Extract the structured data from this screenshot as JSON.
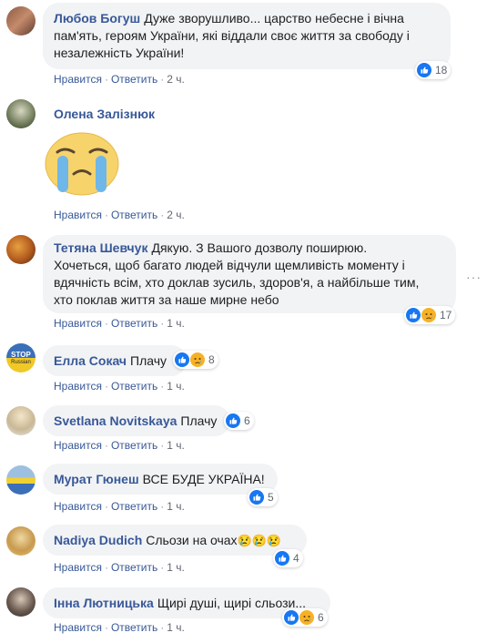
{
  "comments": [
    {
      "author": "Любов Богуш",
      "text_lines": [
        "Дуже зворушливо... царство небесне і вічна",
        "пам'ять, героям України, які віддали своє життя за свободу і",
        "незалежність України!"
      ],
      "like": "Нравится",
      "reply": "Ответить",
      "time": "2 ч.",
      "reactions": [
        "like-reaction-icon"
      ],
      "reaction_count": "18"
    },
    {
      "author": "Олена Залізнюк",
      "text": "",
      "like": "Нравится",
      "reply": "Ответить",
      "time": "2 ч.",
      "sticker": "crying-sticker"
    },
    {
      "author": "Тетяна Шевчук",
      "text_lines": [
        "Дякую. З Вашого дозволу поширюю.",
        "Хочеться, щоб багато людей відчули щемливість моменту і",
        "вдячність всім, хто доклав зусиль, здоров'я, а найбільше тим,",
        "хто поклав життя за наше мирне небо"
      ],
      "like": "Нравится",
      "reply": "Ответить",
      "time": "1 ч.",
      "reactions": [
        "like-reaction-icon",
        "sad-reaction-icon"
      ],
      "reaction_count": "17"
    },
    {
      "author": "Елла Сокач",
      "text": "Плачу",
      "like": "Нравится",
      "reply": "Ответить",
      "time": "1 ч.",
      "reactions": [
        "like-reaction-icon",
        "sad-reaction-icon"
      ],
      "reaction_count": "8",
      "avatar_text": [
        "STOP",
        "Russian"
      ]
    },
    {
      "author": "Svetlana Novitskaya",
      "text": "Плачу",
      "like": "Нравится",
      "reply": "Ответить",
      "time": "1 ч.",
      "reactions": [
        "like-reaction-icon"
      ],
      "reaction_count": "6"
    },
    {
      "author": "Мурат Гюнеш",
      "text": "ВСЕ БУДЕ УКРАЇНА!",
      "like": "Нравится",
      "reply": "Ответить",
      "time": "1 ч.",
      "reactions": [
        "like-reaction-icon"
      ],
      "reaction_count": "5"
    },
    {
      "author": "Nadiya Dudich",
      "text": "Сльози на очах",
      "emojis": "😢😢😢",
      "like": "Нравится",
      "reply": "Ответить",
      "time": "1 ч.",
      "reactions": [
        "like-reaction-icon"
      ],
      "reaction_count": "4"
    },
    {
      "author": "Інна Лютницька",
      "text": "Щирі душі, щирі сльози...",
      "like": "Нравится",
      "reply": "Ответить",
      "time": "1 ч.",
      "reactions": [
        "like-reaction-icon",
        "sad-reaction-icon"
      ],
      "reaction_count": "6"
    }
  ],
  "more_menu_icon": "more-horizontal-icon",
  "colors": {
    "author": "#385898",
    "bubble": "#f2f3f5",
    "like_blue": "#1877f2",
    "sad_yellow": "#f7b125"
  }
}
